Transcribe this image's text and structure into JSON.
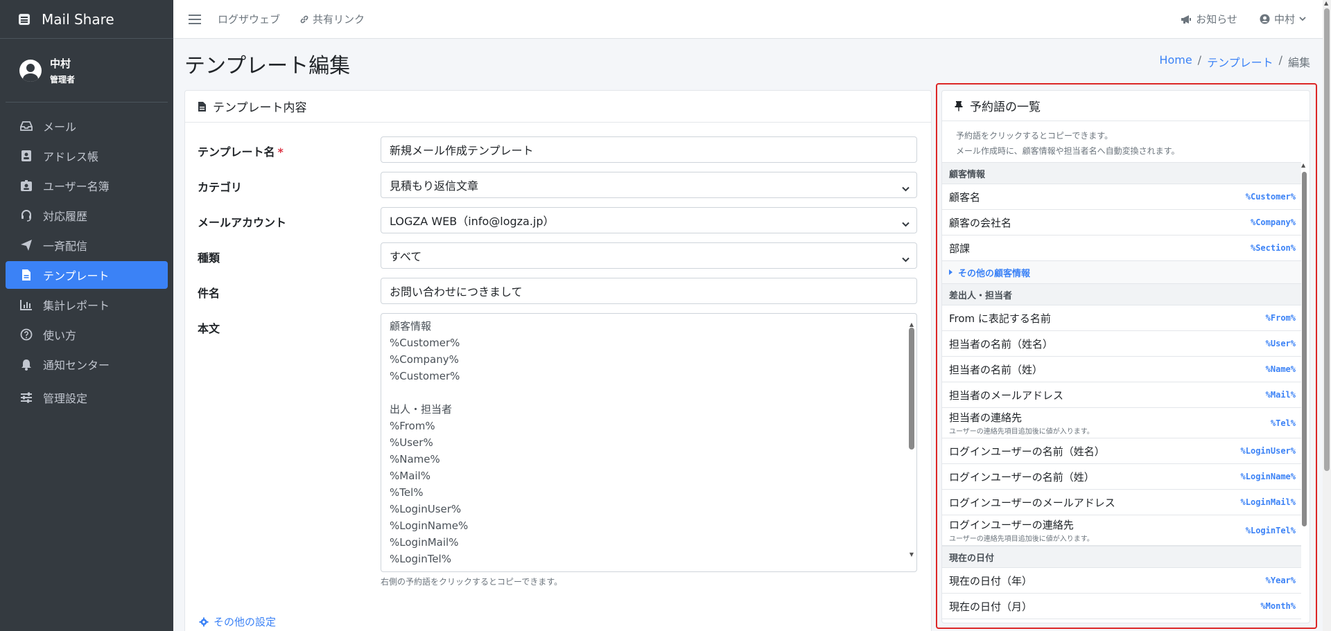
{
  "app": {
    "brand": "Mail Share"
  },
  "user": {
    "name": "中村",
    "role": "管理者"
  },
  "sidebar": {
    "items": [
      {
        "label": "メール",
        "icon": "inbox-icon"
      },
      {
        "label": "アドレス帳",
        "icon": "address-book-icon"
      },
      {
        "label": "ユーザー名簿",
        "icon": "id-card-icon"
      },
      {
        "label": "対応履歴",
        "icon": "headset-icon"
      },
      {
        "label": "一斉配信",
        "icon": "paper-plane-icon"
      },
      {
        "label": "テンプレート",
        "icon": "file-icon",
        "active": true
      },
      {
        "label": "集計レポート",
        "icon": "chart-icon"
      },
      {
        "label": "使い方",
        "icon": "question-circle-icon"
      },
      {
        "label": "通知センター",
        "icon": "bell-icon"
      },
      {
        "label": "管理設定",
        "icon": "sliders-icon"
      }
    ]
  },
  "topbar": {
    "link1": "ログザウェブ",
    "link2": "共有リンク",
    "notices": "お知らせ",
    "user": "中村"
  },
  "page": {
    "title": "テンプレート編集"
  },
  "breadcrumb": {
    "home": "Home",
    "templates": "テンプレート",
    "current": "編集",
    "sep": "/"
  },
  "card": {
    "title": "テンプレート内容"
  },
  "form": {
    "name_label": "テンプレート名",
    "required_mark": "*",
    "name_value": "新規メール作成テンプレート",
    "category_label": "カテゴリ",
    "category_value": "見積もり返信文章",
    "account_label": "メールアカウント",
    "account_value": "LOGZA WEB（info@logza.jp）",
    "type_label": "種類",
    "type_value": "すべて",
    "subject_label": "件名",
    "subject_value": "お問い合わせにつきまして",
    "body_label": "本文",
    "body_lines": [
      "顧客情報",
      "%Customer%",
      "%Company%",
      "%Customer%",
      "",
      "出人・担当者",
      "%From%",
      "%User%",
      "%Name%",
      "%Mail%",
      "%Tel%",
      "%LoginUser%",
      "%LoginName%",
      "%LoginMail%",
      "%LoginTel%"
    ],
    "help": "右側の予約語をクリックするとコピーできます。",
    "other_settings": "その他の設定"
  },
  "reserved": {
    "title": "予約語の一覧",
    "desc1": "予約語をクリックするとコピーできます。",
    "desc2": "メール作成時に、顧客情報や担当者名へ自動変換されます。",
    "group1": "顧客情報",
    "customer": [
      {
        "label": "顧客名",
        "code": "%Customer%"
      },
      {
        "label": "顧客の会社名",
        "code": "%Company%"
      },
      {
        "label": "部課",
        "code": "%Section%"
      }
    ],
    "more_customer": "その他の顧客情報",
    "group2": "差出人・担当者",
    "sender": [
      {
        "label": "From に表記する名前",
        "code": "%From%"
      },
      {
        "label": "担当者の名前（姓名）",
        "code": "%User%"
      },
      {
        "label": "担当者の名前（姓）",
        "code": "%Name%"
      },
      {
        "label": "担当者のメールアドレス",
        "code": "%Mail%"
      },
      {
        "label": "担当者の連絡先",
        "code": "%Tel%",
        "note": "ユーザーの連絡先項目追加後に値が入ります。"
      },
      {
        "label": "ログインユーザーの名前（姓名）",
        "code": "%LoginUser%"
      },
      {
        "label": "ログインユーザーの名前（姓）",
        "code": "%LoginName%"
      },
      {
        "label": "ログインユーザーのメールアドレス",
        "code": "%LoginMail%"
      },
      {
        "label": "ログインユーザーの連絡先",
        "code": "%LoginTel%",
        "note": "ユーザーの連絡先項目追加後に値が入ります。"
      }
    ],
    "group3": "現在の日付",
    "date": [
      {
        "label": "現在の日付（年）",
        "code": "%Year%"
      },
      {
        "label": "現在の日付（月）",
        "code": "%Month%"
      }
    ]
  },
  "colors": {
    "accent": "#3b82f6",
    "sidebar": "#343a40",
    "highlight_border": "#dc2626"
  }
}
